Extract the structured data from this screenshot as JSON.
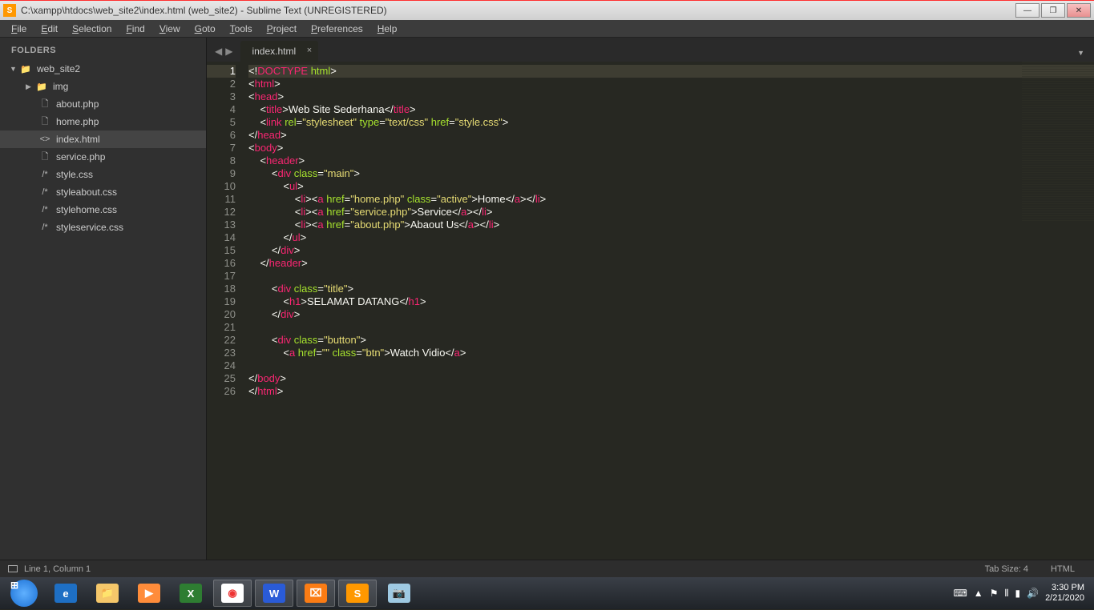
{
  "titlebar": {
    "title": "C:\\xampp\\htdocs\\web_site2\\index.html (web_site2) - Sublime Text (UNREGISTERED)",
    "app_letter": "S"
  },
  "menubar": [
    "File",
    "Edit",
    "Selection",
    "Find",
    "View",
    "Goto",
    "Tools",
    "Project",
    "Preferences",
    "Help"
  ],
  "sidebar": {
    "header": "FOLDERS",
    "root": "web_site2",
    "folder": "img",
    "files": [
      {
        "icon": "php",
        "name": "about.php"
      },
      {
        "icon": "php",
        "name": "home.php"
      },
      {
        "icon": "html",
        "name": "index.html",
        "active": true
      },
      {
        "icon": "php",
        "name": "service.php"
      },
      {
        "icon": "css",
        "name": "style.css"
      },
      {
        "icon": "css",
        "name": "styleabout.css"
      },
      {
        "icon": "css",
        "name": "stylehome.css"
      },
      {
        "icon": "css",
        "name": "styleservice.css"
      }
    ]
  },
  "tab": {
    "name": "index.html"
  },
  "code_lines": [
    [
      {
        "c": "c-white",
        "t": "<!"
      },
      {
        "c": "c-pink",
        "t": "DOCTYPE"
      },
      {
        "c": "c-white",
        "t": " "
      },
      {
        "c": "c-green",
        "t": "html"
      },
      {
        "c": "c-white",
        "t": ">"
      }
    ],
    [
      {
        "c": "c-white",
        "t": "<"
      },
      {
        "c": "c-pink",
        "t": "html"
      },
      {
        "c": "c-white",
        "t": ">"
      }
    ],
    [
      {
        "c": "c-white",
        "t": "<"
      },
      {
        "c": "c-pink",
        "t": "head"
      },
      {
        "c": "c-white",
        "t": ">"
      }
    ],
    [
      {
        "c": "c-white",
        "t": "    <"
      },
      {
        "c": "c-pink",
        "t": "title"
      },
      {
        "c": "c-white",
        "t": ">Web Site Sederhana</"
      },
      {
        "c": "c-pink",
        "t": "title"
      },
      {
        "c": "c-white",
        "t": ">"
      }
    ],
    [
      {
        "c": "c-white",
        "t": "    <"
      },
      {
        "c": "c-pink",
        "t": "link"
      },
      {
        "c": "c-white",
        "t": " "
      },
      {
        "c": "c-green",
        "t": "rel"
      },
      {
        "c": "c-white",
        "t": "="
      },
      {
        "c": "c-yellow",
        "t": "\"stylesheet\""
      },
      {
        "c": "c-white",
        "t": " "
      },
      {
        "c": "c-green",
        "t": "type"
      },
      {
        "c": "c-white",
        "t": "="
      },
      {
        "c": "c-yellow",
        "t": "\"text/css\""
      },
      {
        "c": "c-white",
        "t": " "
      },
      {
        "c": "c-green",
        "t": "href"
      },
      {
        "c": "c-white",
        "t": "="
      },
      {
        "c": "c-yellow",
        "t": "\"style.css\""
      },
      {
        "c": "c-white",
        "t": ">"
      }
    ],
    [
      {
        "c": "c-white",
        "t": "</"
      },
      {
        "c": "c-pink",
        "t": "head"
      },
      {
        "c": "c-white",
        "t": ">"
      }
    ],
    [
      {
        "c": "c-white",
        "t": "<"
      },
      {
        "c": "c-pink",
        "t": "body"
      },
      {
        "c": "c-white",
        "t": ">"
      }
    ],
    [
      {
        "c": "c-white",
        "t": "    <"
      },
      {
        "c": "c-pink",
        "t": "header"
      },
      {
        "c": "c-white",
        "t": ">"
      }
    ],
    [
      {
        "c": "c-white",
        "t": "        <"
      },
      {
        "c": "c-pink",
        "t": "div"
      },
      {
        "c": "c-white",
        "t": " "
      },
      {
        "c": "c-green",
        "t": "class"
      },
      {
        "c": "c-white",
        "t": "="
      },
      {
        "c": "c-yellow",
        "t": "\"main\""
      },
      {
        "c": "c-white",
        "t": ">"
      }
    ],
    [
      {
        "c": "c-white",
        "t": "            <"
      },
      {
        "c": "c-pink",
        "t": "ul"
      },
      {
        "c": "c-white",
        "t": ">"
      }
    ],
    [
      {
        "c": "c-white",
        "t": "                <"
      },
      {
        "c": "c-pink",
        "t": "li"
      },
      {
        "c": "c-white",
        "t": "><"
      },
      {
        "c": "c-pink",
        "t": "a"
      },
      {
        "c": "c-white",
        "t": " "
      },
      {
        "c": "c-green",
        "t": "href"
      },
      {
        "c": "c-white",
        "t": "="
      },
      {
        "c": "c-yellow",
        "t": "\"home.php\""
      },
      {
        "c": "c-white",
        "t": " "
      },
      {
        "c": "c-green",
        "t": "class"
      },
      {
        "c": "c-white",
        "t": "="
      },
      {
        "c": "c-yellow",
        "t": "\"active\""
      },
      {
        "c": "c-white",
        "t": ">Home</"
      },
      {
        "c": "c-pink",
        "t": "a"
      },
      {
        "c": "c-white",
        "t": "></"
      },
      {
        "c": "c-pink",
        "t": "li"
      },
      {
        "c": "c-white",
        "t": ">"
      }
    ],
    [
      {
        "c": "c-white",
        "t": "                <"
      },
      {
        "c": "c-pink",
        "t": "li"
      },
      {
        "c": "c-white",
        "t": "><"
      },
      {
        "c": "c-pink",
        "t": "a"
      },
      {
        "c": "c-white",
        "t": " "
      },
      {
        "c": "c-green",
        "t": "href"
      },
      {
        "c": "c-white",
        "t": "="
      },
      {
        "c": "c-yellow",
        "t": "\"service.php\""
      },
      {
        "c": "c-white",
        "t": ">Service</"
      },
      {
        "c": "c-pink",
        "t": "a"
      },
      {
        "c": "c-white",
        "t": "></"
      },
      {
        "c": "c-pink",
        "t": "li"
      },
      {
        "c": "c-white",
        "t": ">"
      }
    ],
    [
      {
        "c": "c-white",
        "t": "                <"
      },
      {
        "c": "c-pink",
        "t": "li"
      },
      {
        "c": "c-white",
        "t": "><"
      },
      {
        "c": "c-pink",
        "t": "a"
      },
      {
        "c": "c-white",
        "t": " "
      },
      {
        "c": "c-green",
        "t": "href"
      },
      {
        "c": "c-white",
        "t": "="
      },
      {
        "c": "c-yellow",
        "t": "\"about.php\""
      },
      {
        "c": "c-white",
        "t": ">Abaout Us</"
      },
      {
        "c": "c-pink",
        "t": "a"
      },
      {
        "c": "c-white",
        "t": "></"
      },
      {
        "c": "c-pink",
        "t": "li"
      },
      {
        "c": "c-white",
        "t": ">"
      }
    ],
    [
      {
        "c": "c-white",
        "t": "            </"
      },
      {
        "c": "c-pink",
        "t": "ul"
      },
      {
        "c": "c-white",
        "t": ">"
      }
    ],
    [
      {
        "c": "c-white",
        "t": "        </"
      },
      {
        "c": "c-pink",
        "t": "div"
      },
      {
        "c": "c-white",
        "t": ">"
      }
    ],
    [
      {
        "c": "c-white",
        "t": "    </"
      },
      {
        "c": "c-pink",
        "t": "header"
      },
      {
        "c": "c-white",
        "t": ">"
      }
    ],
    [],
    [
      {
        "c": "c-white",
        "t": "        <"
      },
      {
        "c": "c-pink",
        "t": "div"
      },
      {
        "c": "c-white",
        "t": " "
      },
      {
        "c": "c-green",
        "t": "class"
      },
      {
        "c": "c-white",
        "t": "="
      },
      {
        "c": "c-yellow",
        "t": "\"title\""
      },
      {
        "c": "c-white",
        "t": ">"
      }
    ],
    [
      {
        "c": "c-white",
        "t": "            <"
      },
      {
        "c": "c-pink",
        "t": "h1"
      },
      {
        "c": "c-white",
        "t": ">SELAMAT DATANG</"
      },
      {
        "c": "c-pink",
        "t": "h1"
      },
      {
        "c": "c-white",
        "t": ">"
      }
    ],
    [
      {
        "c": "c-white",
        "t": "        </"
      },
      {
        "c": "c-pink",
        "t": "div"
      },
      {
        "c": "c-white",
        "t": ">"
      }
    ],
    [],
    [
      {
        "c": "c-white",
        "t": "        <"
      },
      {
        "c": "c-pink",
        "t": "div"
      },
      {
        "c": "c-white",
        "t": " "
      },
      {
        "c": "c-green",
        "t": "class"
      },
      {
        "c": "c-white",
        "t": "="
      },
      {
        "c": "c-yellow",
        "t": "\"button\""
      },
      {
        "c": "c-white",
        "t": ">"
      }
    ],
    [
      {
        "c": "c-white",
        "t": "            <"
      },
      {
        "c": "c-pink",
        "t": "a"
      },
      {
        "c": "c-white",
        "t": " "
      },
      {
        "c": "c-green",
        "t": "href"
      },
      {
        "c": "c-white",
        "t": "="
      },
      {
        "c": "c-yellow",
        "t": "\"\""
      },
      {
        "c": "c-white",
        "t": " "
      },
      {
        "c": "c-green",
        "t": "class"
      },
      {
        "c": "c-white",
        "t": "="
      },
      {
        "c": "c-yellow",
        "t": "\"btn\""
      },
      {
        "c": "c-white",
        "t": ">Watch Vidio</"
      },
      {
        "c": "c-pink",
        "t": "a"
      },
      {
        "c": "c-white",
        "t": ">"
      }
    ],
    [],
    [
      {
        "c": "c-white",
        "t": "</"
      },
      {
        "c": "c-pink",
        "t": "body"
      },
      {
        "c": "c-white",
        "t": ">"
      }
    ],
    [
      {
        "c": "c-white",
        "t": "</"
      },
      {
        "c": "c-pink",
        "t": "html"
      },
      {
        "c": "c-white",
        "t": ">"
      }
    ]
  ],
  "statusbar": {
    "pos": "Line 1, Column 1",
    "tab": "Tab Size: 4",
    "lang": "HTML"
  },
  "taskbar": {
    "time": "3:30 PM",
    "date": "2/21/2020"
  }
}
